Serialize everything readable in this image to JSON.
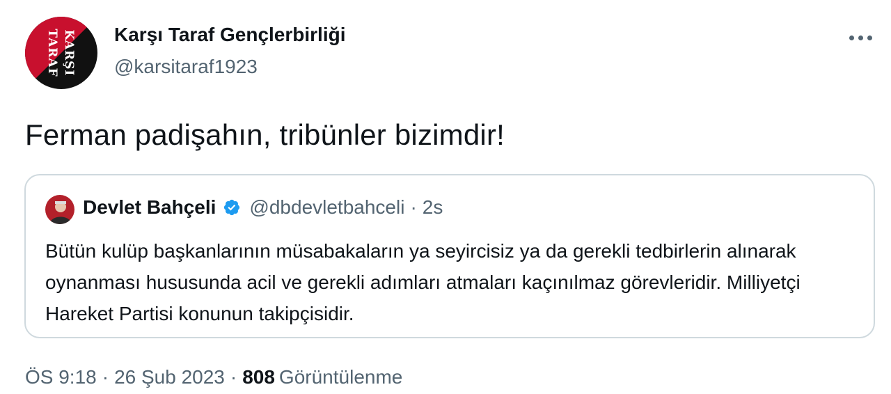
{
  "author": {
    "name": "Karşı Taraf Gençlerbirliği",
    "handle": "@karsitaraf1923",
    "avatar_text": [
      "KARŞI",
      "TARAF"
    ],
    "avatar_colors": {
      "red": "#c8102e",
      "black": "#111111"
    }
  },
  "tweet": {
    "text": "Ferman padişahın, tribünler bizimdir!"
  },
  "quoted": {
    "name": "Devlet Bahçeli",
    "handle": "@dbdevletbahceli",
    "separator": "·",
    "time": "2s",
    "verified_color": "#1d9bf0",
    "text": "Bütün kulüp başkanlarının müsabakaların ya seyircisiz ya da gerekli tedbirlerin alınarak oynanması hususunda acil ve gerekli adımları atmaları kaçınılmaz görevleridir. Milliyetçi Hareket Partisi konunun takipçisidir."
  },
  "meta": {
    "time": "ÖS 9:18",
    "separator": "·",
    "date": "26 Şub 2023",
    "views_count": "808",
    "views_label": "Görüntülenme"
  },
  "icons": {
    "more": "more-options-icon",
    "verified": "verified-badge-icon"
  }
}
